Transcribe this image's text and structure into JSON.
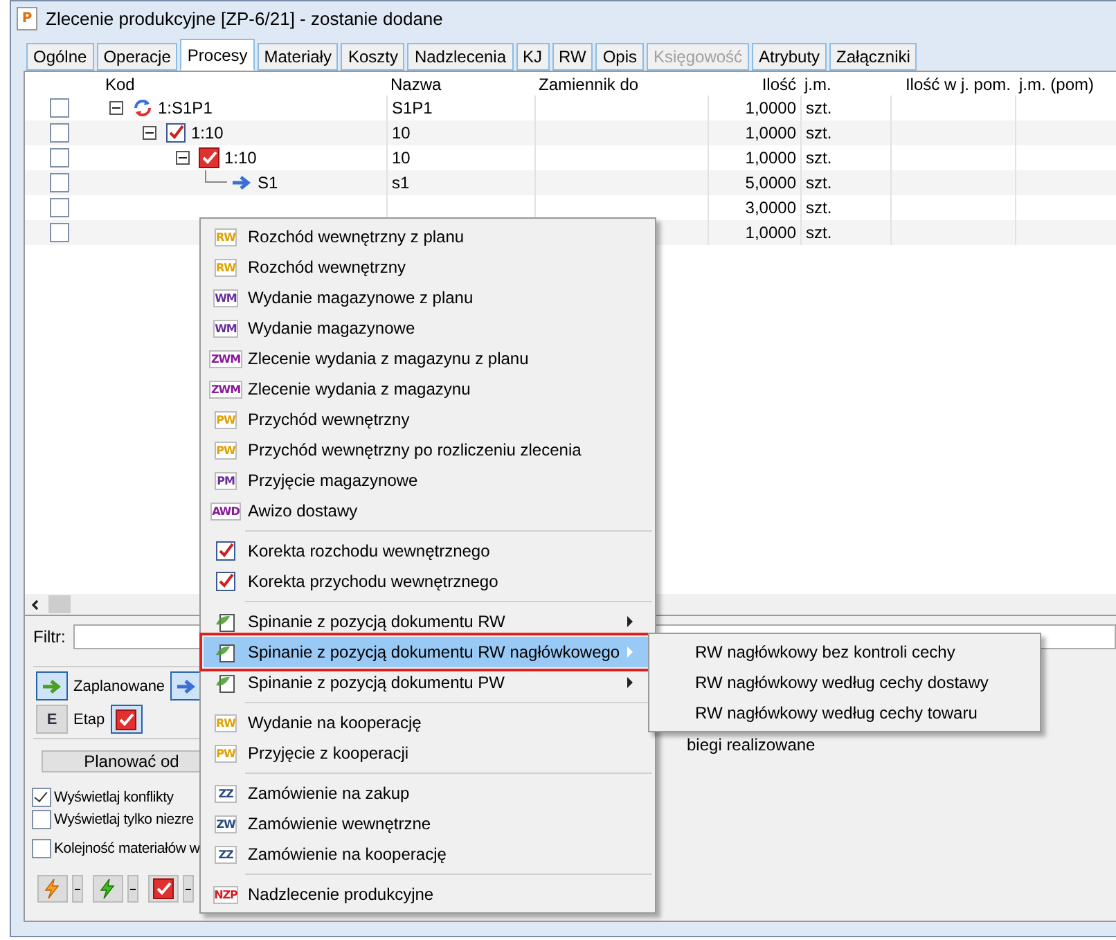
{
  "window": {
    "title": "Zlecenie produkcyjne  [ZP-6/21] - zostanie dodane",
    "icon_text": "P"
  },
  "tabs": [
    {
      "label": "Ogólne",
      "selected": false,
      "disabled": false
    },
    {
      "label": "Operacje",
      "selected": false,
      "disabled": false
    },
    {
      "label": "Procesy",
      "selected": true,
      "disabled": false
    },
    {
      "label": "Materiały",
      "selected": false,
      "disabled": false
    },
    {
      "label": "Koszty",
      "selected": false,
      "disabled": false
    },
    {
      "label": "Nadzlecenia",
      "selected": false,
      "disabled": false
    },
    {
      "label": "KJ",
      "selected": false,
      "disabled": false
    },
    {
      "label": "RW",
      "selected": false,
      "disabled": false
    },
    {
      "label": "Opis",
      "selected": false,
      "disabled": false
    },
    {
      "label": "Księgowość",
      "selected": false,
      "disabled": true
    },
    {
      "label": "Atrybuty",
      "selected": false,
      "disabled": false
    },
    {
      "label": "Załączniki",
      "selected": false,
      "disabled": false
    }
  ],
  "table": {
    "columns": [
      "Kod",
      "Nazwa",
      "Zamiennik do",
      "Ilość",
      "j.m.",
      "Ilość w j. pom.",
      "j.m. (pom)"
    ],
    "rows": [
      {
        "checked": false,
        "kind": "process",
        "expanded": true,
        "kod": "1:S1P1",
        "nazwa": "S1P1",
        "ilosc": "1,0000",
        "jm": "szt.",
        "children": [
          {
            "checked": false,
            "kind": "check",
            "expanded": true,
            "kod": "1:10",
            "nazwa": "10",
            "ilosc": "1,0000",
            "jm": "szt.",
            "children": [
              {
                "checked": false,
                "kind": "check-red",
                "expanded": true,
                "kod": "1:10",
                "nazwa": "10",
                "ilosc": "1,0000",
                "jm": "szt.",
                "children": [
                  {
                    "checked": false,
                    "kind": "arrow",
                    "kod": "S1",
                    "nazwa": "s1",
                    "ilosc": "5,0000",
                    "jm": "szt."
                  },
                  {
                    "checked": false,
                    "ilosc": "3,0000",
                    "jm": "szt."
                  },
                  {
                    "checked": false,
                    "ilosc": "1,0000",
                    "jm": "szt."
                  }
                ]
              }
            ]
          }
        ]
      }
    ]
  },
  "filter": {
    "label": "Filtr:"
  },
  "legend": [
    {
      "kind": "green-arrow",
      "label": "Zaplanowane"
    },
    {
      "kind": "blue-arrow"
    },
    {
      "kind": "etap",
      "label": "Etap",
      "icon_text": "E"
    },
    {
      "kind": "red-check"
    }
  ],
  "hidden_text": "biegi realizowane",
  "plan_button": "Planować od",
  "options": [
    {
      "label": "Wyświetlaj konflikty",
      "checked": true
    },
    {
      "label": "Wyświetlaj tylko niezre",
      "checked": false
    },
    {
      "label": "Kolejność materiałów w",
      "checked": false
    }
  ],
  "toolbar": [
    {
      "kind": "orange-bolt"
    },
    {
      "kind": "green-bolt"
    },
    {
      "kind": "red-check"
    }
  ],
  "context_menu": [
    {
      "kind": "item",
      "badge": "RW",
      "color": "#e0a000",
      "label": "Rozchód wewnętrzny z planu"
    },
    {
      "kind": "item",
      "badge": "RW",
      "color": "#e0a000",
      "label": "Rozchód wewnętrzny"
    },
    {
      "kind": "item",
      "badge": "WM",
      "color": "#6a2e9a",
      "label": "Wydanie magazynowe z planu"
    },
    {
      "kind": "item",
      "badge": "WM",
      "color": "#6a2e9a",
      "label": "Wydanie magazynowe"
    },
    {
      "kind": "item",
      "badge": "ZWM",
      "color": "#8a1a9a",
      "label": "Zlecenie wydania z magazynu z planu"
    },
    {
      "kind": "item",
      "badge": "ZWM",
      "color": "#8a1a9a",
      "label": "Zlecenie wydania z magazynu"
    },
    {
      "kind": "item",
      "badge": "PW",
      "color": "#e0a000",
      "label": "Przychód wewnętrzny"
    },
    {
      "kind": "item",
      "badge": "PW",
      "color": "#e0a000",
      "label": "Przychód wewnętrzny po rozliczeniu zlecenia"
    },
    {
      "kind": "item",
      "badge": "PM",
      "color": "#6a2e9a",
      "label": "Przyjęcie magazynowe"
    },
    {
      "kind": "item",
      "badge": "AWD",
      "color": "#8a1a9a",
      "label": "Awizo dostawy"
    },
    {
      "kind": "separator"
    },
    {
      "kind": "check",
      "label": "Korekta rozchodu wewnętrznego"
    },
    {
      "kind": "check",
      "label": "Korekta przychodu wewnętrznego"
    },
    {
      "kind": "separator"
    },
    {
      "kind": "link",
      "label": "Spinanie z pozycją dokumentu RW",
      "submenu": true,
      "selected": false
    },
    {
      "kind": "link",
      "label": "Spinanie z pozycją dokumentu RW nagłówkowego",
      "submenu": true,
      "selected": true
    },
    {
      "kind": "link",
      "label": "Spinanie z pozycją dokumentu PW",
      "submenu": true,
      "selected": false
    },
    {
      "kind": "separator"
    },
    {
      "kind": "item",
      "badge": "RW",
      "color": "#e0a000",
      "label": "Wydanie na kooperację"
    },
    {
      "kind": "item",
      "badge": "PW",
      "color": "#e0a000",
      "label": "Przyjęcie z kooperacji"
    },
    {
      "kind": "separator"
    },
    {
      "kind": "item",
      "badge": "ZZ",
      "color": "#2a4a80",
      "label": "Zamówienie na zakup"
    },
    {
      "kind": "item",
      "badge": "ZW",
      "color": "#2a4a80",
      "label": "Zamówienie wewnętrzne"
    },
    {
      "kind": "item",
      "badge": "ZZ",
      "color": "#2a4a80",
      "label": "Zamówienie na kooperację"
    },
    {
      "kind": "separator"
    },
    {
      "kind": "item",
      "badge": "NZP",
      "color": "#d02020",
      "label": "Nadzlecenie produkcyjne"
    }
  ],
  "submenu": [
    "RW nagłówkowy bez kontroli cechy",
    "RW nagłówkowy według cechy dostawy",
    "RW nagłówkowy według cechy towaru"
  ]
}
